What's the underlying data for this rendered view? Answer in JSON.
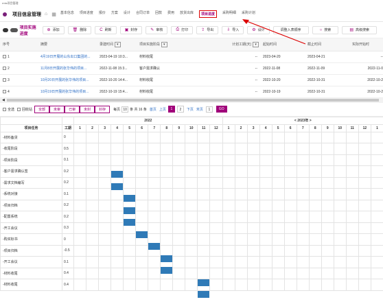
{
  "app": {
    "brand": "rmis项目管理"
  },
  "nav": {
    "title": "项目信息管理",
    "tabs": [
      "基本信息",
      "项目进度",
      "报价",
      "方案",
      "设计",
      "合同订单",
      "回款",
      "费用",
      "放货出库",
      "项目进度",
      "采购明细",
      "采购计划"
    ],
    "active_index": 9
  },
  "toolbar": {
    "title": "项目实施进度",
    "buttons": [
      {
        "label": "添加",
        "icon": "⊕"
      },
      {
        "label": "删除",
        "icon": "🗑"
      },
      {
        "label": "刷新",
        "icon": "C"
      },
      {
        "label": "封存",
        "icon": "▣"
      },
      {
        "label": "审核",
        "icon": "✎"
      },
      {
        "label": "打印",
        "icon": "⎙"
      },
      {
        "label": "导出",
        "icon": "⇪"
      },
      {
        "label": "导入",
        "icon": "⇩"
      },
      {
        "label": "设计",
        "icon": "⚙"
      },
      {
        "label": "调整入表顺序",
        "icon": ""
      },
      {
        "label": "搜索",
        "icon": "○"
      },
      {
        "label": "高级搜索",
        "icon": "▤"
      }
    ]
  },
  "table": {
    "headers": [
      "序号",
      "摘要",
      "录建时间",
      "项目实施阶段",
      "计划工期(天)",
      "起始时间",
      "截止时间",
      "实际开始时"
    ],
    "rows": [
      {
        "no": "1",
        "summary": "4月19日开展的山东出口集团的...",
        "created": "2023-04-19 10:3...",
        "stage": "材料收尾",
        "days": "--",
        "start": "2023-04-20",
        "end": "2023-04-21",
        "actual": "--"
      },
      {
        "no": "2",
        "summary": "11月8日开展的张华伟的项目...",
        "created": "2022-11-08 15:3...",
        "stage": "客户需求确认",
        "days": "--",
        "start": "2022-11-08",
        "end": "2022-11-09",
        "actual": "2022-11-0"
      },
      {
        "no": "3",
        "summary": "10月20日开展的张华伟的项目...",
        "created": "2022-10-20 14:4...",
        "stage": "材料收尾",
        "days": "--",
        "start": "2022-10-20",
        "end": "2022-10-31",
        "actual": "2022-10-2"
      },
      {
        "no": "4",
        "summary": "10月19日开展的张华伟的项目...",
        "created": "2022-10-19 15:4...",
        "stage": "材料收尾",
        "days": "--",
        "start": "2022-10-19",
        "end": "2022-10-31",
        "actual": "2022-10-2"
      }
    ]
  },
  "filter": {
    "select_all": "全选",
    "recycle": "回收站",
    "states": [
      "全部",
      "未审",
      "已审",
      "未封",
      "封存"
    ],
    "per_page_prefix": "每页",
    "per_page": "10",
    "total_text": "条 共 16 条",
    "first": "首页",
    "prev": "上页",
    "pages": [
      "1",
      "2"
    ],
    "current_page": "1",
    "next": "下页",
    "last": "末页",
    "goto": "1",
    "go": "GO"
  },
  "gantt": {
    "task_header": "项目任务",
    "hours_header": "工期",
    "year_left": "2022",
    "year_right": "< 2023年 >",
    "months_left": [
      "1",
      "2",
      "3",
      "4",
      "5",
      "6",
      "7",
      "8",
      "9",
      "10",
      "11",
      "12"
    ],
    "months_right": [
      "1",
      "2",
      "3",
      "4",
      "5",
      "6",
      "7",
      "8",
      "9",
      "10",
      "11",
      "12",
      "1"
    ],
    "rows": [
      {
        "task": "-材料备货",
        "hours": "0",
        "col": null
      },
      {
        "task": "-收尾阶段",
        "hours": "0.5",
        "col": null
      },
      {
        "task": "-项目阶段",
        "hours": "0.1",
        "col": null
      },
      {
        "task": "-客户需求确认签",
        "hours": "0.2",
        "col": 3
      },
      {
        "task": "-需求文档编写",
        "hours": "0.2",
        "col": 3
      },
      {
        "task": "-系统对接",
        "hours": "0.1",
        "col": 4
      },
      {
        "task": "-项目归档",
        "hours": "0.2",
        "col": 4
      },
      {
        "task": "-配置系统",
        "hours": "0.2",
        "col": 4
      },
      {
        "task": "-开工会议",
        "hours": "0.3",
        "col": 5
      },
      {
        "task": "-购买标书",
        "hours": "0",
        "col": 6
      },
      {
        "task": "-项目归档",
        "hours": "-0.5",
        "col": 7
      },
      {
        "task": "-开工会议",
        "hours": "0.1",
        "col": 7
      },
      {
        "task": "-材料收尾",
        "hours": "0.4",
        "col": 10
      },
      {
        "task": "-材料收尾",
        "hours": "0.4",
        "col": 10
      }
    ]
  },
  "colors": {
    "accent": "#a0007a",
    "bar": "#2f7ab7",
    "link": "#2e6fc6"
  }
}
